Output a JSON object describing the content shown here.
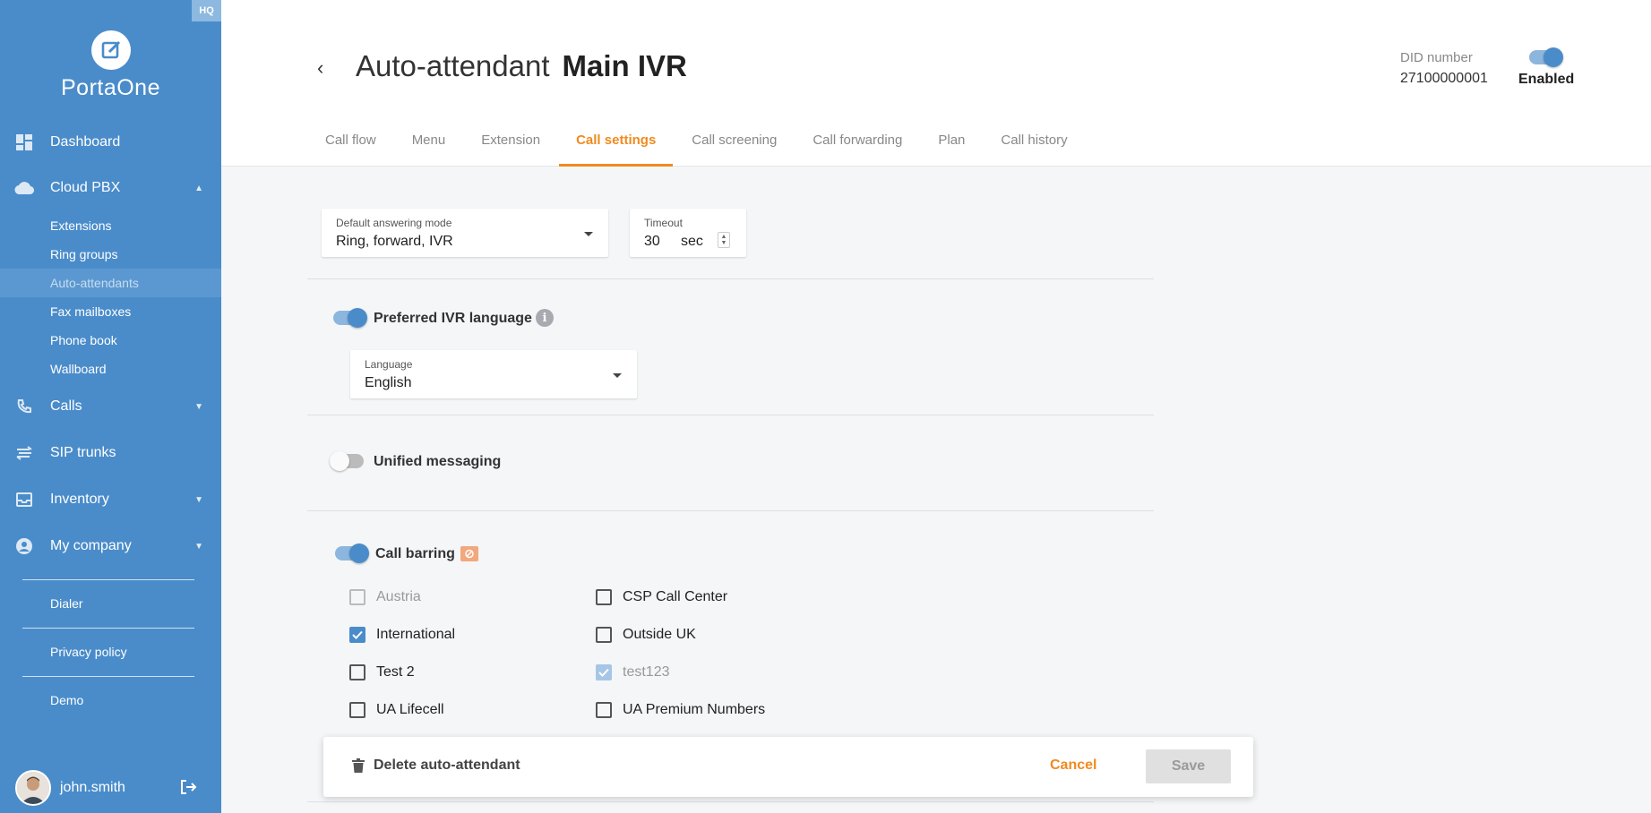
{
  "sidebar": {
    "hq_badge": "HQ",
    "brand": "PortaOne",
    "nav": {
      "dashboard": "Dashboard",
      "cloud_pbx": "Cloud PBX",
      "calls": "Calls",
      "sip_trunks": "SIP trunks",
      "inventory": "Inventory",
      "my_company": "My company"
    },
    "cloud_pbx_items": [
      "Extensions",
      "Ring groups",
      "Auto-attendants",
      "Fax mailboxes",
      "Phone book",
      "Wallboard"
    ],
    "links": {
      "dialer": "Dialer",
      "privacy": "Privacy policy",
      "demo": "Demo"
    },
    "user": "john.smith"
  },
  "header": {
    "title": "Auto-attendant",
    "name": "Main IVR",
    "did_label": "DID number",
    "did_number": "27100000001",
    "status": "Enabled",
    "tabs": [
      "Call flow",
      "Menu",
      "Extension",
      "Call settings",
      "Call screening",
      "Call forwarding",
      "Plan",
      "Call history"
    ],
    "active_tab": "Call settings"
  },
  "call_settings": {
    "answering_mode": {
      "label": "Default answering mode",
      "value": "Ring, forward, IVR"
    },
    "timeout": {
      "label": "Timeout",
      "value": "30",
      "unit": "sec"
    },
    "ivr_language": {
      "label": "Preferred IVR language",
      "enabled": true,
      "field_label": "Language",
      "value": "English"
    },
    "unified_messaging": {
      "label": "Unified messaging",
      "enabled": false
    },
    "call_barring": {
      "label": "Call barring",
      "enabled": true,
      "items": [
        {
          "name": "Austria",
          "checked": false,
          "disabled": true
        },
        {
          "name": "CSP Call Center",
          "checked": false,
          "disabled": false
        },
        {
          "name": "International",
          "checked": true,
          "disabled": false
        },
        {
          "name": "Outside UK",
          "checked": false,
          "disabled": false
        },
        {
          "name": "Test 2",
          "checked": false,
          "disabled": false
        },
        {
          "name": "test123",
          "checked": true,
          "disabled": true
        },
        {
          "name": "UA Lifecell",
          "checked": false,
          "disabled": false
        },
        {
          "name": "UA Premium Numbers",
          "checked": false,
          "disabled": false
        }
      ]
    }
  },
  "footer": {
    "delete": "Delete auto-attendant",
    "cancel": "Cancel",
    "save": "Save"
  },
  "colors": {
    "sidebar": "#4a8cca",
    "accent": "#f18a1f",
    "toggle_on": "#4a8cca"
  },
  "icons": [
    "dashboard-icon",
    "cloud-icon",
    "phone-icon",
    "trunk-icon",
    "inventory-icon",
    "account-icon",
    "logout-icon",
    "trash-icon",
    "info-icon",
    "chevron-icon"
  ]
}
